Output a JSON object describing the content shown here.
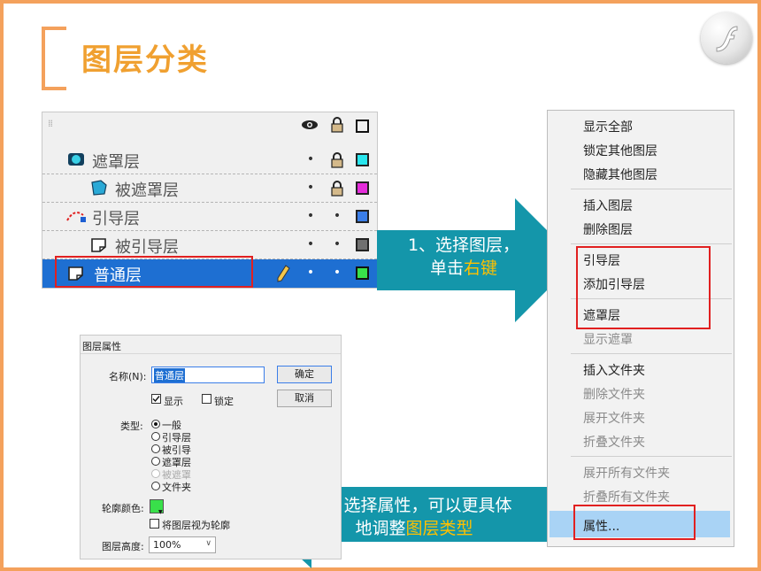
{
  "slide": {
    "title": "图层分类"
  },
  "timeline": {
    "header_icons": [
      "eye-icon",
      "lock-icon",
      "outline-icon"
    ],
    "layers": [
      {
        "name": "遮罩层",
        "icon": "mask-layer-icon",
        "show": "•",
        "locked": true,
        "color": "#29e6ee"
      },
      {
        "name": "被遮罩层",
        "icon": "masked-layer-icon",
        "show": "•",
        "locked": true,
        "color": "#e52ddb"
      },
      {
        "name": "引导层",
        "icon": "guide-layer-icon",
        "show": "•",
        "lock": "•",
        "color": "#3b7ee8"
      },
      {
        "name": "被引导层",
        "icon": "guided-layer-icon",
        "show": "•",
        "lock": "•",
        "color": "#707070"
      },
      {
        "name": "普通层",
        "icon": "normal-layer-icon",
        "show": "•",
        "lock": "•",
        "color": "#39e04a",
        "selected": true
      }
    ]
  },
  "steps": {
    "step1_line1": "1、选择图层，",
    "step1_line2_a": "单击",
    "step1_line2_b": "右键",
    "step2_line1": "2、选择属性，可以更具体",
    "step2_line2_a": "地调整",
    "step2_line2_b": "图层类型"
  },
  "context_menu": {
    "show_all": "显示全部",
    "lock_others": "锁定其他图层",
    "hide_others": "隐藏其他图层",
    "insert_layer": "插入图层",
    "delete_layer": "删除图层",
    "guide": "引导层",
    "add_guide": "添加引导层",
    "mask": "遮罩层",
    "show_mask": "显示遮罩",
    "insert_folder": "插入文件夹",
    "delete_folder": "删除文件夹",
    "expand_folder": "展开文件夹",
    "collapse_folder": "折叠文件夹",
    "expand_all": "展开所有文件夹",
    "collapse_all": "折叠所有文件夹",
    "properties": "属性..."
  },
  "dialog": {
    "title": "图层属性",
    "name_label": "名称(N):",
    "name_value": "普通层",
    "ok": "确定",
    "cancel": "取消",
    "show_label": "显示",
    "lock_label": "锁定",
    "type_label": "类型:",
    "types": [
      "一般",
      "引导层",
      "被引导",
      "遮罩层",
      "被遮罩",
      "文件夹"
    ],
    "outline_color_label": "轮廓颜色:",
    "outline_color": "#39e04a",
    "view_outline_label": "将图层视为轮廓",
    "height_label": "图层高度:",
    "height_value": "100%"
  },
  "colors": {
    "accent_orange": "#f4a15c",
    "title_orange": "#f0a030",
    "arrow_teal": "#1496aa",
    "highlight_yellow": "#ffc000",
    "select_blue": "#1e6fd2",
    "annotation_red": "#e12020"
  }
}
